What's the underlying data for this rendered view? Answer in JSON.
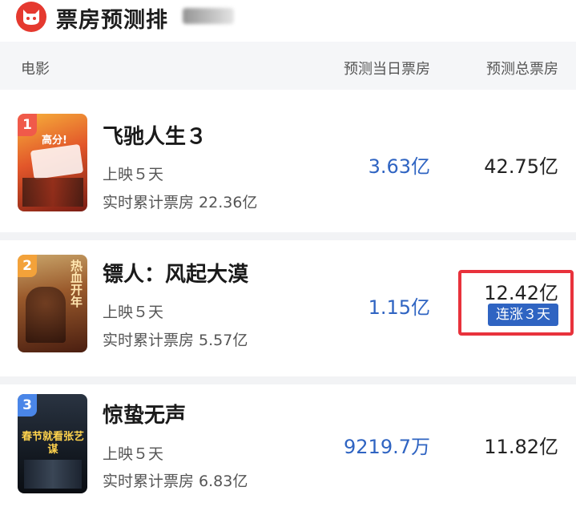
{
  "app": {
    "title": "票房预测排",
    "logo_icon": "cat-logo-icon"
  },
  "columns": {
    "movie": "电影",
    "today": "预测当日票房",
    "total": "预测总票房"
  },
  "movies": [
    {
      "rank": "1",
      "rank_color": "#f05a4a",
      "name": "飞驰人生３",
      "days": "上映５天",
      "cumulative": "实时累计票房 22.36亿",
      "today": "3.63亿",
      "total": "42.75亿",
      "poster_text": "高分!"
    },
    {
      "rank": "2",
      "rank_color": "#f3a23a",
      "name": "镖人：风起大漠",
      "days": "上映５天",
      "cumulative": "实时累计票房 5.57亿",
      "today": "1.15亿",
      "total": "12.42亿",
      "streak": "连涨３天",
      "poster_text": "热血开年"
    },
    {
      "rank": "3",
      "rank_color": "#4a86e8",
      "name": "惊蛰无声",
      "days": "上映５天",
      "cumulative": "实时累计票房 6.83亿",
      "today": "9219.7万",
      "total": "11.82亿",
      "poster_text": "春节就看张艺谋"
    }
  ]
}
